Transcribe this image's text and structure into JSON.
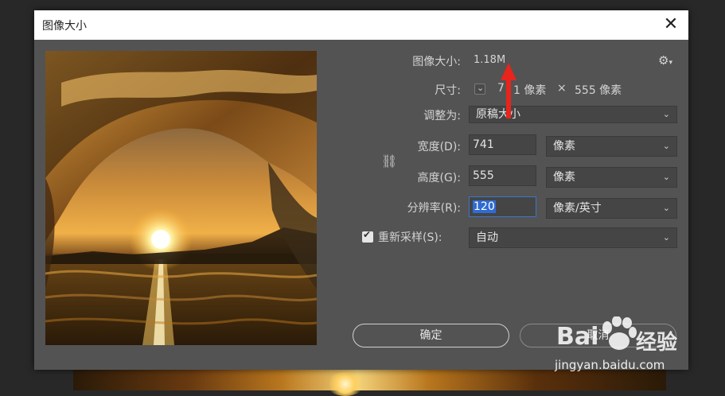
{
  "dialog": {
    "title": "图像大小",
    "close_glyph": "✕"
  },
  "info": {
    "size_label": "图像大小:",
    "size_value": "1.18M",
    "dimensions_label": "尺寸:",
    "width_px": "741 像素",
    "times": "×",
    "height_px": "555 像素",
    "dimensions_value_visible_left": "7",
    "dimensions_value_visible_right": "1 像素"
  },
  "fit_to": {
    "label": "调整为:",
    "value": "原稿大小"
  },
  "width": {
    "label": "宽度(D):",
    "value": "741",
    "unit": "像素"
  },
  "height": {
    "label": "高度(G):",
    "value": "555",
    "unit": "像素"
  },
  "resolution": {
    "label": "分辨率(R):",
    "value": "120",
    "unit": "像素/英寸"
  },
  "resample": {
    "label": "重新采样(S):",
    "value": "自动",
    "checked": true
  },
  "buttons": {
    "ok": "确定",
    "cancel": "取消"
  },
  "watermark": {
    "brand": "Bai",
    "brand_tail": "经验",
    "url": "jingyan.baidu.com"
  },
  "colors": {
    "dialog_bg": "#535353",
    "field_bg": "#454545",
    "accent": "#3d76c6",
    "arrow": "#e8241c"
  }
}
